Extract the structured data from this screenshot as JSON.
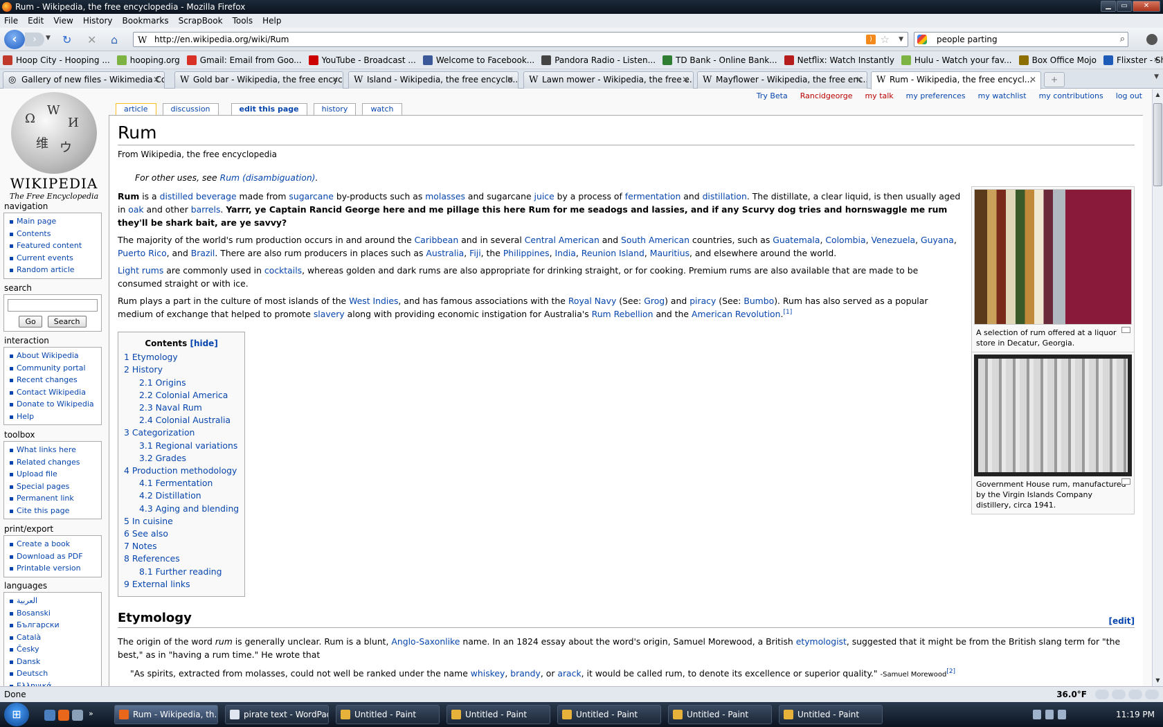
{
  "window": {
    "title": "Rum - Wikipedia, the free encyclopedia - Mozilla Firefox"
  },
  "menu": [
    "File",
    "Edit",
    "View",
    "History",
    "Bookmarks",
    "ScrapBook",
    "Tools",
    "Help"
  ],
  "url": "http://en.wikipedia.org/wiki/Rum",
  "search_value": "people parting",
  "bookmarks": [
    {
      "label": "Hoop City - Hooping ...",
      "color": "#c0392b"
    },
    {
      "label": "hooping.org",
      "color": "#7cb342"
    },
    {
      "label": "Gmail: Email from Goo...",
      "color": "#d93025"
    },
    {
      "label": "YouTube - Broadcast ...",
      "color": "#cc0000"
    },
    {
      "label": "Welcome to Facebook...",
      "color": "#3b5998"
    },
    {
      "label": "Pandora Radio - Listen...",
      "color": "#444444"
    },
    {
      "label": "TD Bank - Online Bank...",
      "color": "#2e7d32"
    },
    {
      "label": "Netflix: Watch Instantly",
      "color": "#b71c1c"
    },
    {
      "label": "Hulu - Watch your fav...",
      "color": "#7cb342"
    },
    {
      "label": "Box Office Mojo",
      "color": "#8d6e00"
    },
    {
      "label": "Flixster - Share Movie ...",
      "color": "#1e5bb8"
    }
  ],
  "tabs": [
    {
      "label": "Gallery of new files - Wikimedia Co..."
    },
    {
      "label": "Gold bar - Wikipedia, the free encyc..."
    },
    {
      "label": "Island - Wikipedia, the free encyclo..."
    },
    {
      "label": "Lawn mower - Wikipedia, the free e..."
    },
    {
      "label": "Mayflower - Wikipedia, the free enc..."
    },
    {
      "label": "Rum - Wikipedia, the free encycl..."
    }
  ],
  "personal": [
    "Try Beta",
    "Rancidgeorge",
    "my talk",
    "my preferences",
    "my watchlist",
    "my contributions",
    "log out"
  ],
  "page_tabs": [
    "article",
    "discussion",
    "edit this page",
    "history",
    "watch"
  ],
  "logo": {
    "title": "WIKIPEDIA",
    "subtitle": "The Free Encyclopedia"
  },
  "sidebar": {
    "navigation": {
      "title": "navigation",
      "items": [
        "Main page",
        "Contents",
        "Featured content",
        "Current events",
        "Random article"
      ]
    },
    "search": {
      "title": "search",
      "go": "Go",
      "search": "Search"
    },
    "interaction": {
      "title": "interaction",
      "items": [
        "About Wikipedia",
        "Community portal",
        "Recent changes",
        "Contact Wikipedia",
        "Donate to Wikipedia",
        "Help"
      ]
    },
    "toolbox": {
      "title": "toolbox",
      "items": [
        "What links here",
        "Related changes",
        "Upload file",
        "Special pages",
        "Permanent link",
        "Cite this page"
      ]
    },
    "print": {
      "title": "print/export",
      "items": [
        "Create a book",
        "Download as PDF",
        "Printable version"
      ]
    },
    "languages": {
      "title": "languages",
      "items": [
        "العربية",
        "Bosanski",
        "Български",
        "Català",
        "Česky",
        "Dansk",
        "Deutsch",
        "Ελληνικά"
      ]
    }
  },
  "article": {
    "title": "Rum",
    "sitesub": "From Wikipedia, the free encyclopedia",
    "hatnote_pre": "For other uses, see ",
    "hatnote_link": "Rum (disambiguation)",
    "hatnote_post": ".",
    "toc_title": "Contents",
    "toc_hide": "[hide]",
    "toc": [
      {
        "num": "1",
        "text": "Etymology",
        "level": 1
      },
      {
        "num": "2",
        "text": "History",
        "level": 1
      },
      {
        "num": "2.1",
        "text": "Origins",
        "level": 2
      },
      {
        "num": "2.2",
        "text": "Colonial America",
        "level": 2
      },
      {
        "num": "2.3",
        "text": "Naval Rum",
        "level": 2
      },
      {
        "num": "2.4",
        "text": "Colonial Australia",
        "level": 2
      },
      {
        "num": "3",
        "text": "Categorization",
        "level": 1
      },
      {
        "num": "3.1",
        "text": "Regional variations",
        "level": 2
      },
      {
        "num": "3.2",
        "text": "Grades",
        "level": 2
      },
      {
        "num": "4",
        "text": "Production methodology",
        "level": 1
      },
      {
        "num": "4.1",
        "text": "Fermentation",
        "level": 2
      },
      {
        "num": "4.2",
        "text": "Distillation",
        "level": 2
      },
      {
        "num": "4.3",
        "text": "Aging and blending",
        "level": 2
      },
      {
        "num": "5",
        "text": "In cuisine",
        "level": 1
      },
      {
        "num": "6",
        "text": "See also",
        "level": 1
      },
      {
        "num": "7",
        "text": "Notes",
        "level": 1
      },
      {
        "num": "8",
        "text": "References",
        "level": 1
      },
      {
        "num": "8.1",
        "text": "Further reading",
        "level": 2
      },
      {
        "num": "9",
        "text": "External links",
        "level": 1
      }
    ],
    "section_etymology": "Etymology",
    "edit_label": "[edit]",
    "quote_attr": "-Samuel Morewood",
    "quote_ref": "[2]",
    "caption1": "A selection of rum offered at a liquor store in Decatur, Georgia.",
    "caption2": "Government House rum, manufactured by the Virgin Islands Company distillery, circa 1941."
  },
  "status": {
    "text": "Done",
    "temp": "36.0°F"
  },
  "taskbar": [
    {
      "label": "Rum - Wikipedia, th...",
      "active": true,
      "color": "#e8671b"
    },
    {
      "label": "pirate text - WordPad",
      "active": false,
      "color": "#dfe6ef"
    },
    {
      "label": "Untitled - Paint",
      "active": false,
      "color": "#e6b23a"
    },
    {
      "label": "Untitled - Paint",
      "active": false,
      "color": "#e6b23a"
    },
    {
      "label": "Untitled - Paint",
      "active": false,
      "color": "#e6b23a"
    },
    {
      "label": "Untitled - Paint",
      "active": false,
      "color": "#e6b23a"
    },
    {
      "label": "Untitled - Paint",
      "active": false,
      "color": "#e6b23a"
    }
  ],
  "clock": "11:19 PM"
}
